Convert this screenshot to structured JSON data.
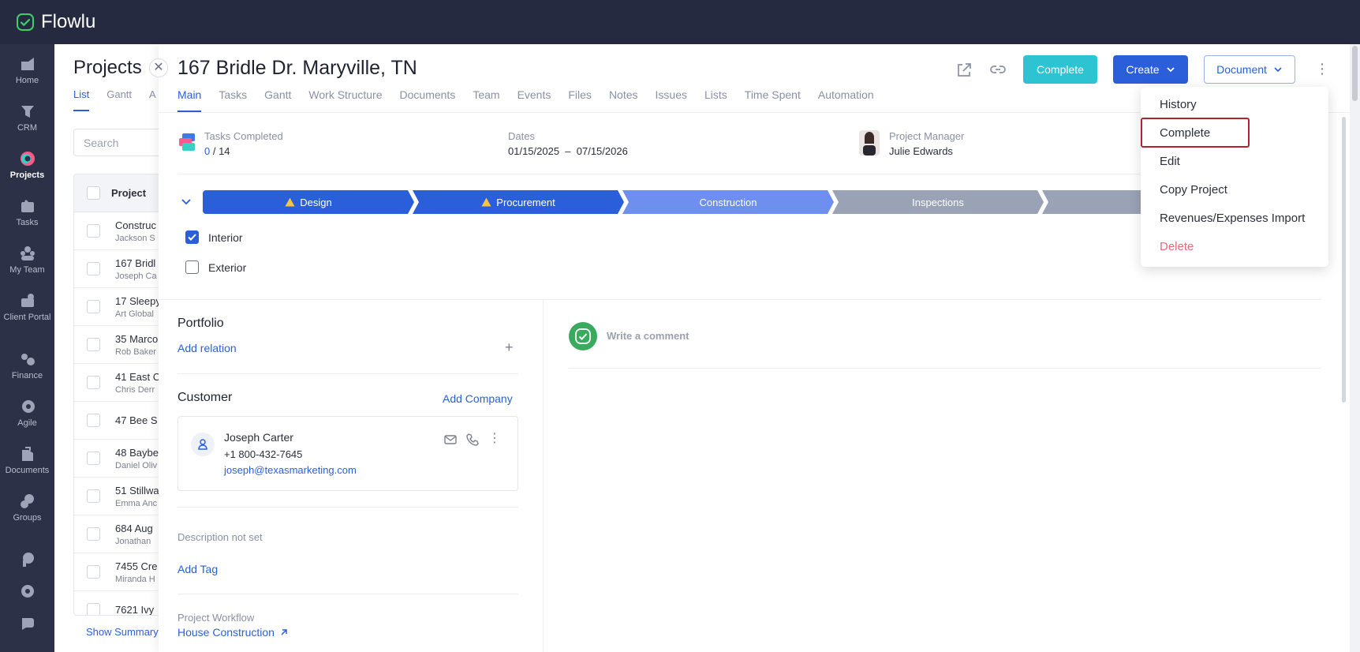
{
  "app": {
    "name": "Flowlu"
  },
  "nav": [
    {
      "label": "Home",
      "icon": "home-icon"
    },
    {
      "label": "CRM",
      "icon": "crm-icon"
    },
    {
      "label": "Projects",
      "icon": "projects-icon",
      "active": true
    },
    {
      "label": "Tasks",
      "icon": "tasks-icon"
    },
    {
      "label": "My Team",
      "icon": "team-icon"
    },
    {
      "label": "Client Portal",
      "icon": "portal-icon"
    },
    {
      "label": "Finance",
      "icon": "finance-icon"
    },
    {
      "label": "Agile",
      "icon": "agile-icon"
    },
    {
      "label": "Documents",
      "icon": "documents-icon"
    },
    {
      "label": "Groups",
      "icon": "groups-icon"
    },
    {
      "label": "",
      "icon": "knowledge-icon"
    },
    {
      "label": "",
      "icon": "settings-icon"
    },
    {
      "label": "",
      "icon": "chat-icon"
    }
  ],
  "list": {
    "title": "Projects",
    "tabs": [
      "List",
      "Gantt",
      "A"
    ],
    "search_placeholder": "Search",
    "column": "Project",
    "rows": [
      {
        "name": "Construc",
        "sub": "Jackson S"
      },
      {
        "name": "167 Bridl",
        "sub": "Joseph Ca"
      },
      {
        "name": "17 Sleepy",
        "sub": "Art Global"
      },
      {
        "name": "35 Marco",
        "sub": "Rob Baker"
      },
      {
        "name": "41 East C",
        "sub": "Chris Derr"
      },
      {
        "name": "47 Bee S",
        "sub": ""
      },
      {
        "name": "48 Baybe",
        "sub": "Daniel Oliv"
      },
      {
        "name": "51 Stillwa",
        "sub": "Emma Anc"
      },
      {
        "name": "684 Aug",
        "sub": "Jonathan"
      },
      {
        "name": "7455 Cre",
        "sub": "Miranda H"
      },
      {
        "name": "7621 Ivy",
        "sub": ""
      }
    ],
    "show_summary": "Show Summary"
  },
  "project": {
    "title": "167 Bridle Dr. Maryville, TN",
    "tabs": [
      "Main",
      "Tasks",
      "Gantt",
      "Work Structure",
      "Documents",
      "Team",
      "Events",
      "Files",
      "Notes",
      "Issues",
      "Lists",
      "Time Spent",
      "Automation"
    ],
    "buttons": {
      "complete": "Complete",
      "create": "Create",
      "document": "Document"
    },
    "tasks_completed": {
      "label": "Tasks Completed",
      "done": "0",
      "sep": " / ",
      "total": "14"
    },
    "dates": {
      "label": "Dates",
      "value": "01/15/2025  –  07/15/2026"
    },
    "manager": {
      "label": "Project Manager",
      "name": "Julie Edwards"
    },
    "stages": [
      {
        "label": "Design",
        "warn": true,
        "color": "#2b5fd9"
      },
      {
        "label": "Procurement",
        "warn": true,
        "color": "#2b5fd9"
      },
      {
        "label": "Construction",
        "warn": false,
        "color": "#6f8ff0"
      },
      {
        "label": "Inspections",
        "warn": false,
        "color": "#9aa3b5"
      },
      {
        "label": "",
        "warn": false,
        "color": "#9aa3b5"
      }
    ],
    "checklist": [
      {
        "label": "Interior",
        "checked": true
      },
      {
        "label": "Exterior",
        "checked": false
      }
    ],
    "portfolio": {
      "title": "Portfolio",
      "add": "Add relation"
    },
    "customer": {
      "title": "Customer",
      "add": "Add Company",
      "name": "Joseph Carter",
      "phone": "+1 800-432-7645",
      "email": "joseph@texasmarketing.com"
    },
    "description": "Description not set",
    "add_tag": "Add Tag",
    "workflow": {
      "label": "Project Workflow",
      "value": "House Construction"
    },
    "comment_placeholder": "Write a comment"
  },
  "menu": {
    "items": [
      "History",
      "Complete",
      "Edit",
      "Copy Project",
      "Revenues/Expenses Import",
      "Delete"
    ],
    "highlighted": "Complete"
  },
  "colors": {
    "accent": "#2b5fd9",
    "complete": "#2dc3d2",
    "danger": "#e8687a",
    "topbar": "#262a40"
  }
}
